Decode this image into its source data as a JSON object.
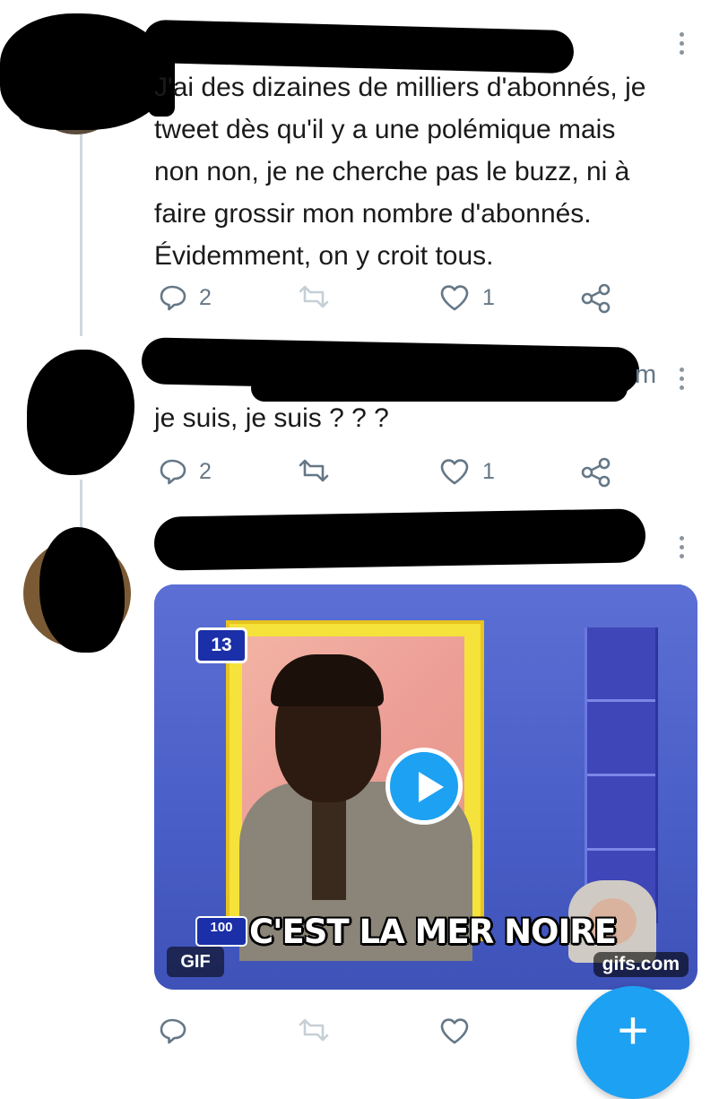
{
  "tweets": [
    {
      "text": "J'ai des dizaines de milliers d'abonnés, je\ntweet dès qu'il y a une polémique mais\nnon non, je ne cherche pas le buzz, ni à\nfaire grossir mon nombre d'abonnés.\nÉvidemment, on y croit tous.",
      "reply_count": "2",
      "like_count": "1"
    },
    {
      "handle_fragment": "m",
      "text": "je suis, je suis ? ? ?",
      "reply_count": "2",
      "like_count": "1"
    },
    {
      "media": {
        "badge_top": "13",
        "badge_bottom": "100",
        "caption": "C'EST LA MER NOIRE",
        "gif_label": "GIF",
        "source_label": "gifs.com"
      }
    }
  ],
  "icons": {
    "reply": "reply-icon",
    "retweet": "retweet-icon",
    "like": "heart-icon",
    "share": "share-icon",
    "more": "more-vertical-icon",
    "play": "play-icon",
    "compose": "plus-icon"
  },
  "fab": {
    "symbol": "+"
  },
  "colors": {
    "accent": "#1da1f2",
    "muted": "#657786",
    "thread_line": "#cfd9de",
    "redaction": "#000000"
  }
}
